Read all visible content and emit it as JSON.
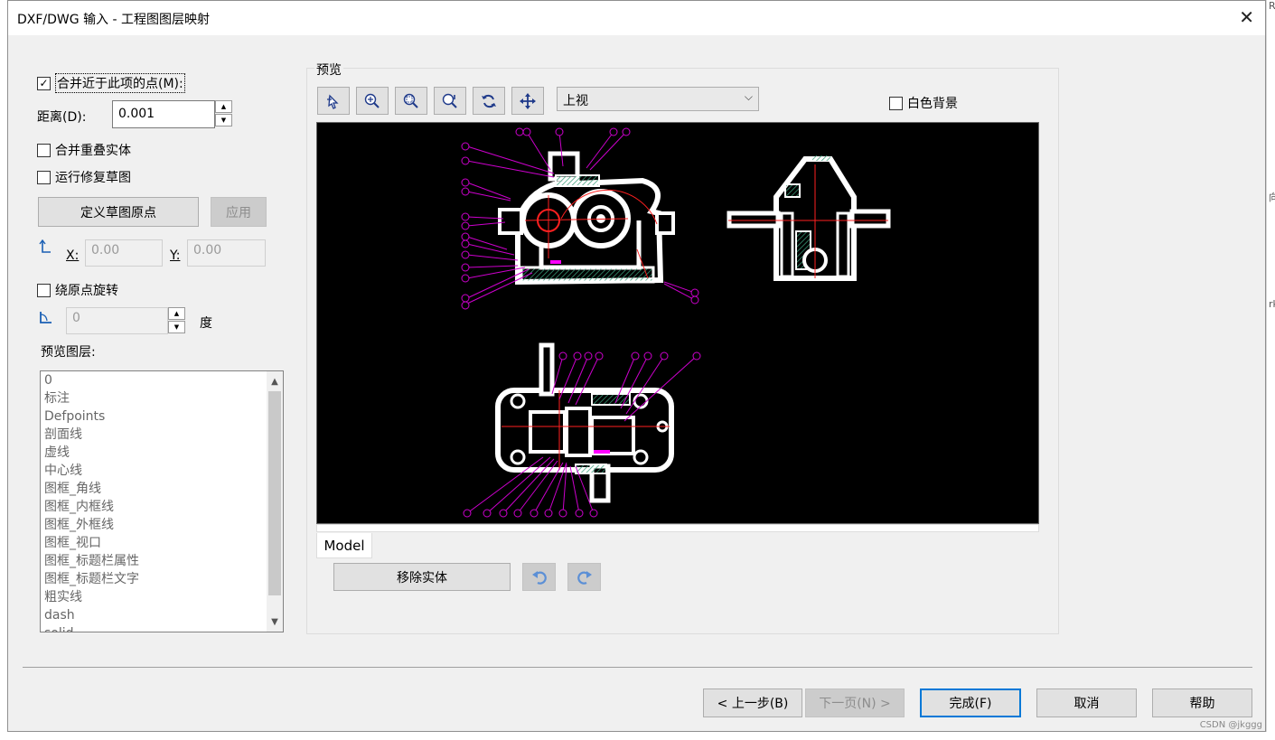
{
  "window": {
    "title": "DXF/DWG 输入 - 工程图图层映射"
  },
  "left": {
    "merge_points_label": "合并近于此项的点(M):",
    "merge_points_checked": true,
    "distance_label": "距离(D):",
    "distance_value": "0.001",
    "merge_overlap_label": "合并重叠实体",
    "run_repair_label": "运行修复草图",
    "define_origin_button": "定义草图原点",
    "apply_button": "应用",
    "x_label": "X:",
    "x_value": "0.00",
    "y_label": "Y:",
    "y_value": "0.00",
    "rotate_label": "绕原点旋转",
    "angle_value": "0",
    "angle_unit": "度",
    "layers_label": "预览图层:",
    "layers": [
      "0",
      "标注",
      "Defpoints",
      "剖面线",
      "虚线",
      "中心线",
      "图框_角线",
      "图框_内框线",
      "图框_外框线",
      "图框_视口",
      "图框_标题栏属性",
      "图框_标题栏文字",
      "粗实线",
      "dash",
      "solid"
    ]
  },
  "preview": {
    "group_label": "预览",
    "view_select": "上视",
    "white_bg_label": "白色背景",
    "model_tab": "Model",
    "remove_entity_button": "移除实体"
  },
  "footer": {
    "back_button": "< 上一步(B)",
    "next_button": "下一页(N) >",
    "finish_button": "完成(F)",
    "cancel_button": "取消",
    "help_button": "帮助"
  },
  "watermark": "CSDN @jkggg",
  "background": {
    "side_text_1": "R",
    "side_text_2": "向",
    "side_text_3": "rk"
  },
  "colors": {
    "accent": "#0078d7",
    "drawing_outline": "#ffffff",
    "leader": "#cc00cc",
    "center": "#ff2020",
    "hatch": "#3a9e7a"
  }
}
